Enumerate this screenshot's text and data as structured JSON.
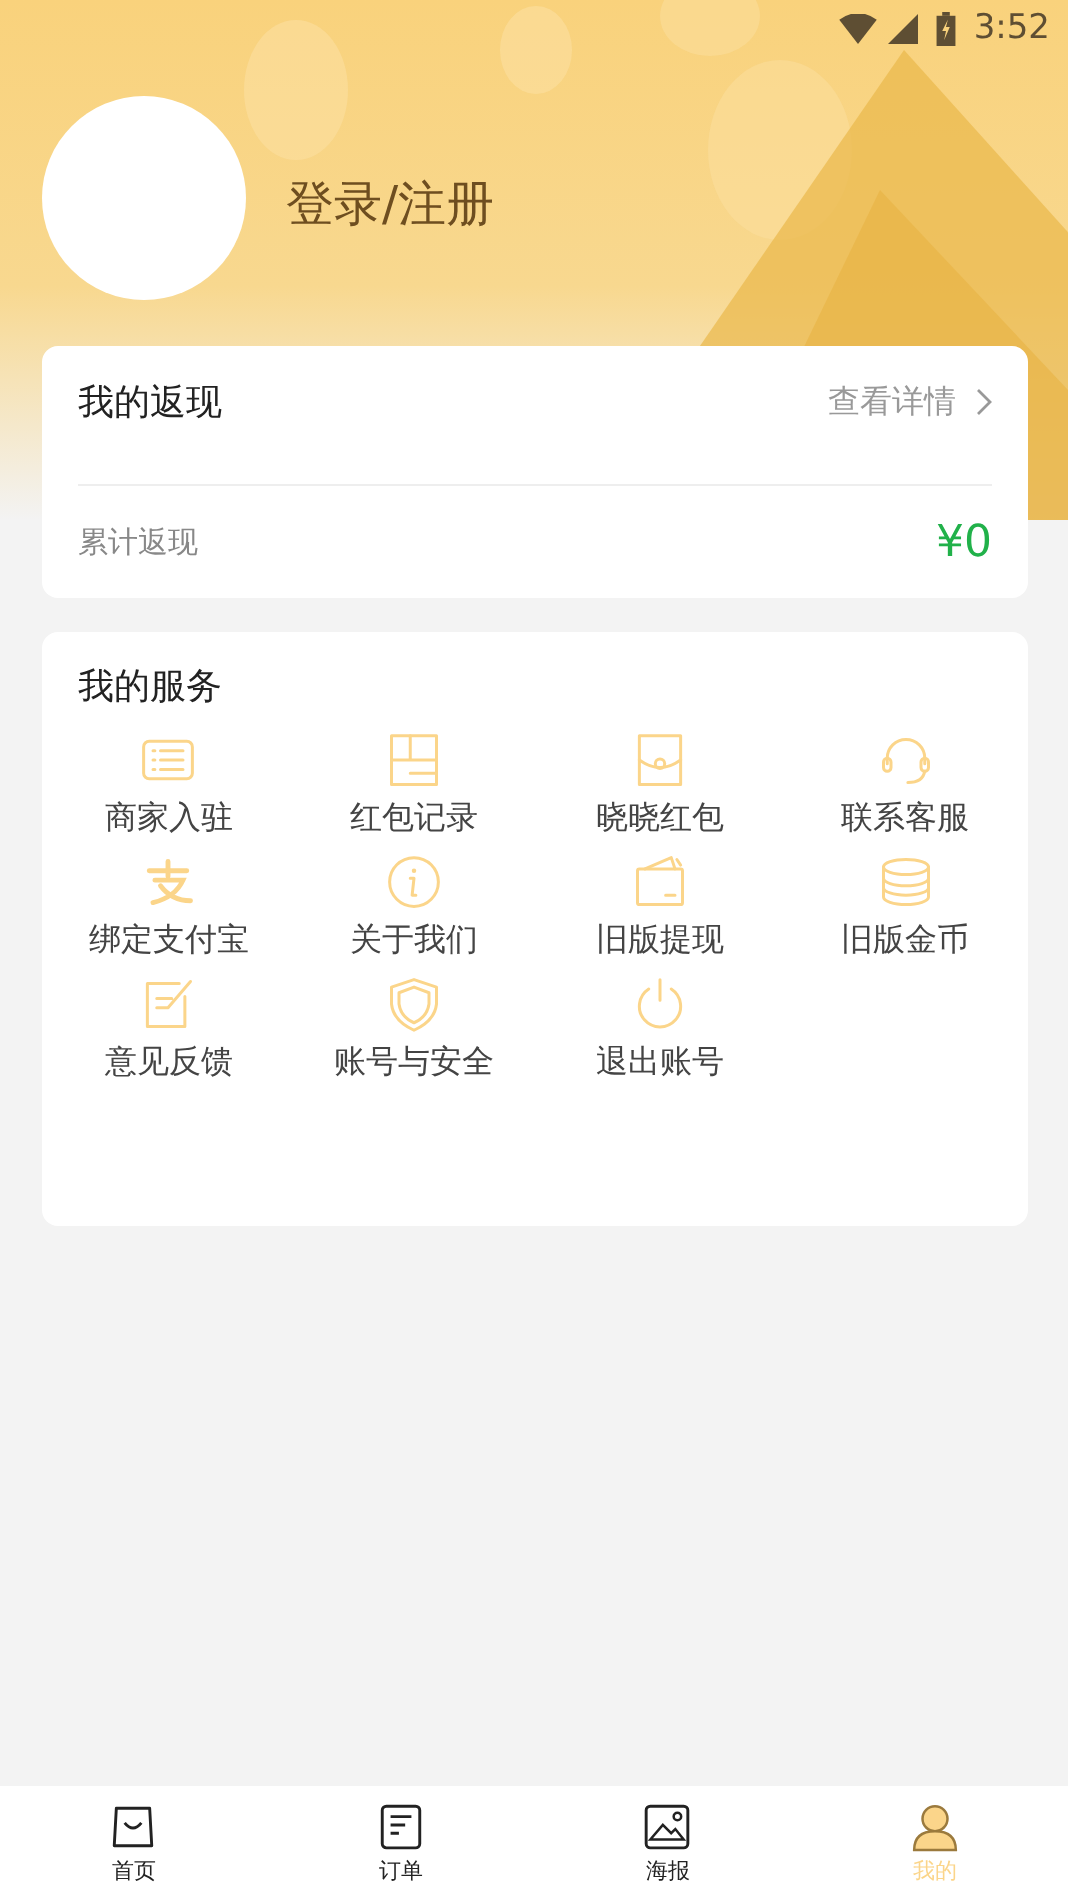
{
  "status_bar": {
    "time": "3:52"
  },
  "profile": {
    "login_label": "登录/注册"
  },
  "cashback": {
    "title": "我的返现",
    "details_link": "查看详情",
    "total_label": "累计返现",
    "total_value": "¥0"
  },
  "services": {
    "title": "我的服务",
    "items": [
      {
        "label": "商家入驻"
      },
      {
        "label": "红包记录"
      },
      {
        "label": "晓晓红包"
      },
      {
        "label": "联系客服"
      },
      {
        "label": "绑定支付宝"
      },
      {
        "label": "关于我们"
      },
      {
        "label": "旧版提现"
      },
      {
        "label": "旧版金币"
      },
      {
        "label": "意见反馈"
      },
      {
        "label": "账号与安全"
      },
      {
        "label": "退出账号"
      }
    ]
  },
  "tab_bar": [
    {
      "label": "首页",
      "selected": false
    },
    {
      "label": "订单",
      "selected": false
    },
    {
      "label": "海报",
      "selected": false
    },
    {
      "label": "我的",
      "selected": true
    }
  ]
}
